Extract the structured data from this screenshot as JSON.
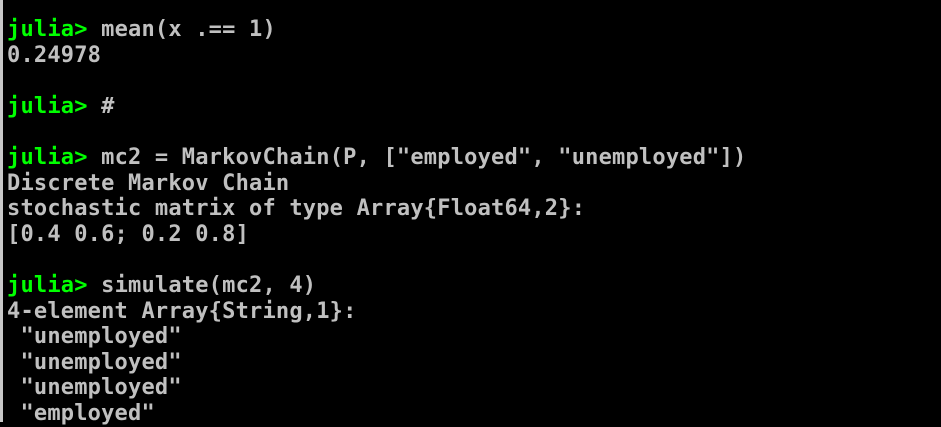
{
  "terminal": {
    "prompt": "julia>",
    "blocks": [
      {
        "command": "mean(x .== 1)",
        "output": [
          "0.24978"
        ]
      },
      {
        "command": "#",
        "output": []
      },
      {
        "command": "mc2 = MarkovChain(P, [\"employed\", \"unemployed\"])",
        "output": [
          "Discrete Markov Chain",
          "stochastic matrix of type Array{Float64,2}:",
          "[0.4 0.6; 0.2 0.8]"
        ]
      },
      {
        "command": "simulate(mc2, 4)",
        "output": [
          "4-element Array{String,1}:",
          " \"unemployed\"",
          " \"unemployed\"",
          " \"unemployed\"",
          " \"employed\""
        ]
      }
    ]
  },
  "colors": {
    "background": "#000000",
    "prompt": "#00ff00",
    "text": "#c0c0c0"
  }
}
